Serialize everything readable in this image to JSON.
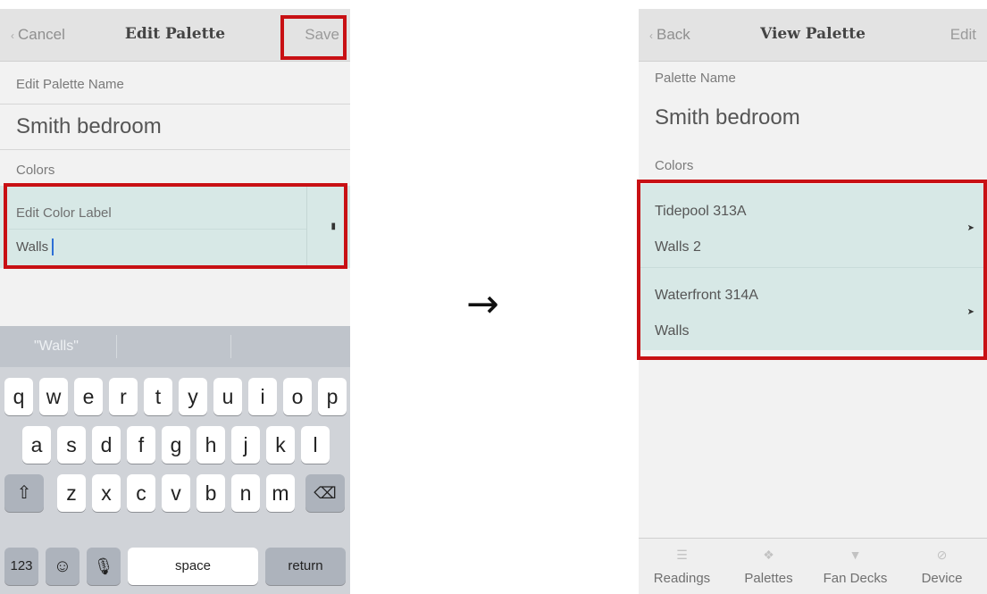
{
  "left": {
    "nav": {
      "cancel": "Cancel",
      "title": "Edit Palette",
      "save": "Save"
    },
    "palette_name_label": "Edit Palette Name",
    "palette_name": "Smith bedroom",
    "colors_label": "Colors",
    "color_label_heading": "Edit Color Label",
    "color_label_value": "Walls",
    "keyboard": {
      "suggestion": "\"Walls\"",
      "row1": [
        "q",
        "w",
        "e",
        "r",
        "t",
        "y",
        "u",
        "i",
        "o",
        "p"
      ],
      "row2": [
        "a",
        "s",
        "d",
        "f",
        "g",
        "h",
        "j",
        "k",
        "l"
      ],
      "row3": [
        "z",
        "x",
        "c",
        "v",
        "b",
        "n",
        "m"
      ],
      "numbers": "123",
      "space": "space",
      "return": "return",
      "icons": {
        "shift": "shift-icon",
        "delete": "delete-icon",
        "emoji": "emoji-icon",
        "mic": "mic-icon"
      }
    }
  },
  "right": {
    "nav": {
      "back": "Back",
      "title": "View Palette",
      "edit": "Edit"
    },
    "palette_name_label": "Palette Name",
    "palette_name": "Smith bedroom",
    "colors_label": "Colors",
    "colors": [
      {
        "name": "Tidepool 313A",
        "label": "Walls 2"
      },
      {
        "name": "Waterfront 314A",
        "label": "Walls"
      }
    ],
    "tabs": [
      {
        "label": "Readings",
        "icon": "readings-icon"
      },
      {
        "label": "Palettes",
        "icon": "palettes-icon"
      },
      {
        "label": "Fan Decks",
        "icon": "fan-decks-icon"
      },
      {
        "label": "Device",
        "icon": "device-icon"
      }
    ]
  },
  "colors": {
    "highlight": "#c81014",
    "row_fill": "#d7e8e6"
  }
}
